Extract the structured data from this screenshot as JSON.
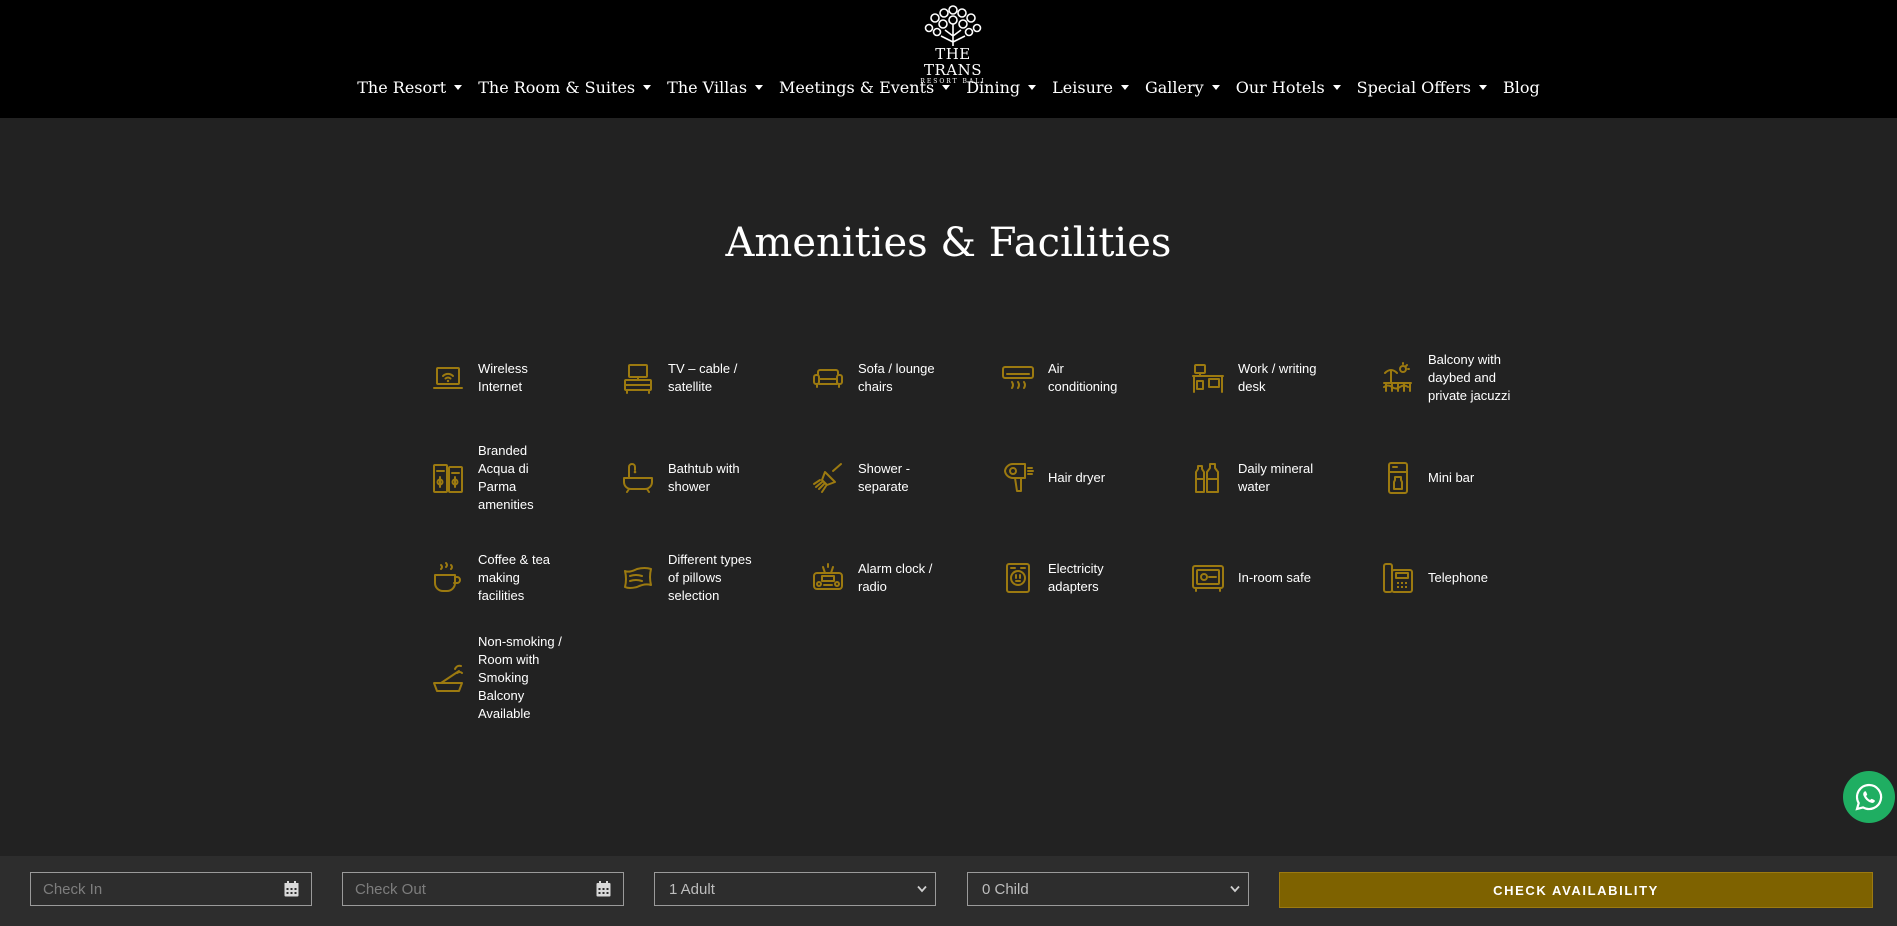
{
  "header": {
    "logo_main": "THE TRANS",
    "logo_sub": "RESORT BALI",
    "nav": [
      {
        "label": "The Resort",
        "dropdown": true
      },
      {
        "label": "The Room & Suites",
        "dropdown": true
      },
      {
        "label": "The Villas",
        "dropdown": true
      },
      {
        "label": "Meetings & Events",
        "dropdown": true
      },
      {
        "label": "Dining",
        "dropdown": true
      },
      {
        "label": "Leisure",
        "dropdown": true
      },
      {
        "label": "Gallery",
        "dropdown": true
      },
      {
        "label": "Our Hotels",
        "dropdown": true
      },
      {
        "label": "Special Offers",
        "dropdown": true
      },
      {
        "label": "Blog",
        "dropdown": false
      }
    ]
  },
  "section": {
    "title": "Amenities & Facilities",
    "amenities": [
      {
        "label": "Wireless Internet",
        "icon": "wifi-laptop-icon"
      },
      {
        "label": "TV – cable / satellite",
        "icon": "tv-icon"
      },
      {
        "label": "Sofa / lounge chairs",
        "icon": "sofa-icon"
      },
      {
        "label": "Air conditioning",
        "icon": "air-conditioner-icon"
      },
      {
        "label": "Work / writing desk",
        "icon": "desk-icon"
      },
      {
        "label": "Balcony with daybed and private jacuzzi",
        "icon": "balcony-icon"
      },
      {
        "label": "Branded Acqua di Parma amenities",
        "icon": "toiletries-icon"
      },
      {
        "label": "Bathtub with shower",
        "icon": "bathtub-icon"
      },
      {
        "label": "Shower - separate",
        "icon": "shower-icon"
      },
      {
        "label": "Hair dryer",
        "icon": "hair-dryer-icon"
      },
      {
        "label": "Daily mineral water",
        "icon": "water-bottles-icon"
      },
      {
        "label": "Mini bar",
        "icon": "mini-bar-icon"
      },
      {
        "label": "Coffee & tea making facilities",
        "icon": "coffee-cup-icon"
      },
      {
        "label": "Different types of pillows selection",
        "icon": "pillow-icon"
      },
      {
        "label": "Alarm clock / radio",
        "icon": "alarm-radio-icon"
      },
      {
        "label": "Electricity adapters",
        "icon": "power-adapter-icon"
      },
      {
        "label": "In-room safe",
        "icon": "safe-icon"
      },
      {
        "label": "Telephone",
        "icon": "telephone-icon"
      },
      {
        "label": "Non-smoking / Room with Smoking Balcony Available",
        "icon": "smoking-icon"
      }
    ]
  },
  "booking": {
    "check_in_placeholder": "Check In",
    "check_out_placeholder": "Check Out",
    "adults_value": "1 Adult",
    "children_value": "0 Child",
    "submit_label": "CHECK AVAILABILITY"
  },
  "colors": {
    "accent": "#9c7a10",
    "button": "#7e6200",
    "background": "#222222",
    "header": "#000000",
    "whatsapp": "#1fae62"
  }
}
